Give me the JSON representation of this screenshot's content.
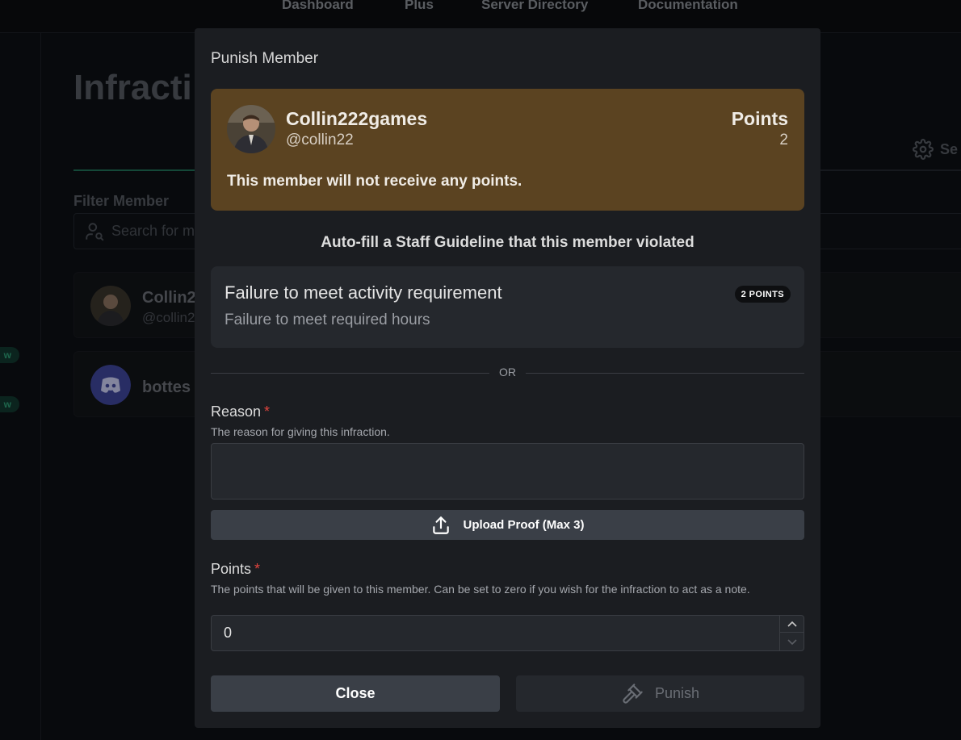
{
  "topnav": {
    "links": [
      "Dashboard",
      "Plus",
      "Server Directory",
      "Documentation"
    ]
  },
  "page": {
    "title": "Infracti",
    "settings_tab": "Se",
    "filter_label": "Filter Member",
    "filter_placeholder": "Search for me",
    "members": [
      {
        "name": "Collin2",
        "handle": "@collin2"
      },
      {
        "name": "bottes",
        "handle": ""
      }
    ],
    "side_badge": "w"
  },
  "modal": {
    "title": "Punish Member",
    "member": {
      "name": "Collin222games",
      "handle": "@collin22",
      "points_label": "Points",
      "points_value": "2",
      "notice": "This member will not receive any points."
    },
    "autofill_heading": "Auto-fill a Staff Guideline that this member violated",
    "guideline": {
      "title": "Failure to meet activity requirement",
      "subtitle": "Failure to meet required hours",
      "badge": "2 POINTS"
    },
    "or_text": "OR",
    "reason": {
      "label": "Reason",
      "required_mark": "*",
      "description": "The reason for giving this infraction.",
      "value": ""
    },
    "upload_label": "Upload Proof (Max 3)",
    "points": {
      "label": "Points",
      "required_mark": "*",
      "description": "The points that will be given to this member. Can be set to zero if you wish for the infraction to act as a note.",
      "value": "0"
    },
    "close_label": "Close",
    "punish_label": "Punish"
  },
  "colors": {
    "modal_bg": "#1b1d21",
    "member_box": "#5b4321",
    "required": "#e0443e",
    "accent_green": "#1f6f57",
    "discord_blurple": "#5865f2"
  }
}
